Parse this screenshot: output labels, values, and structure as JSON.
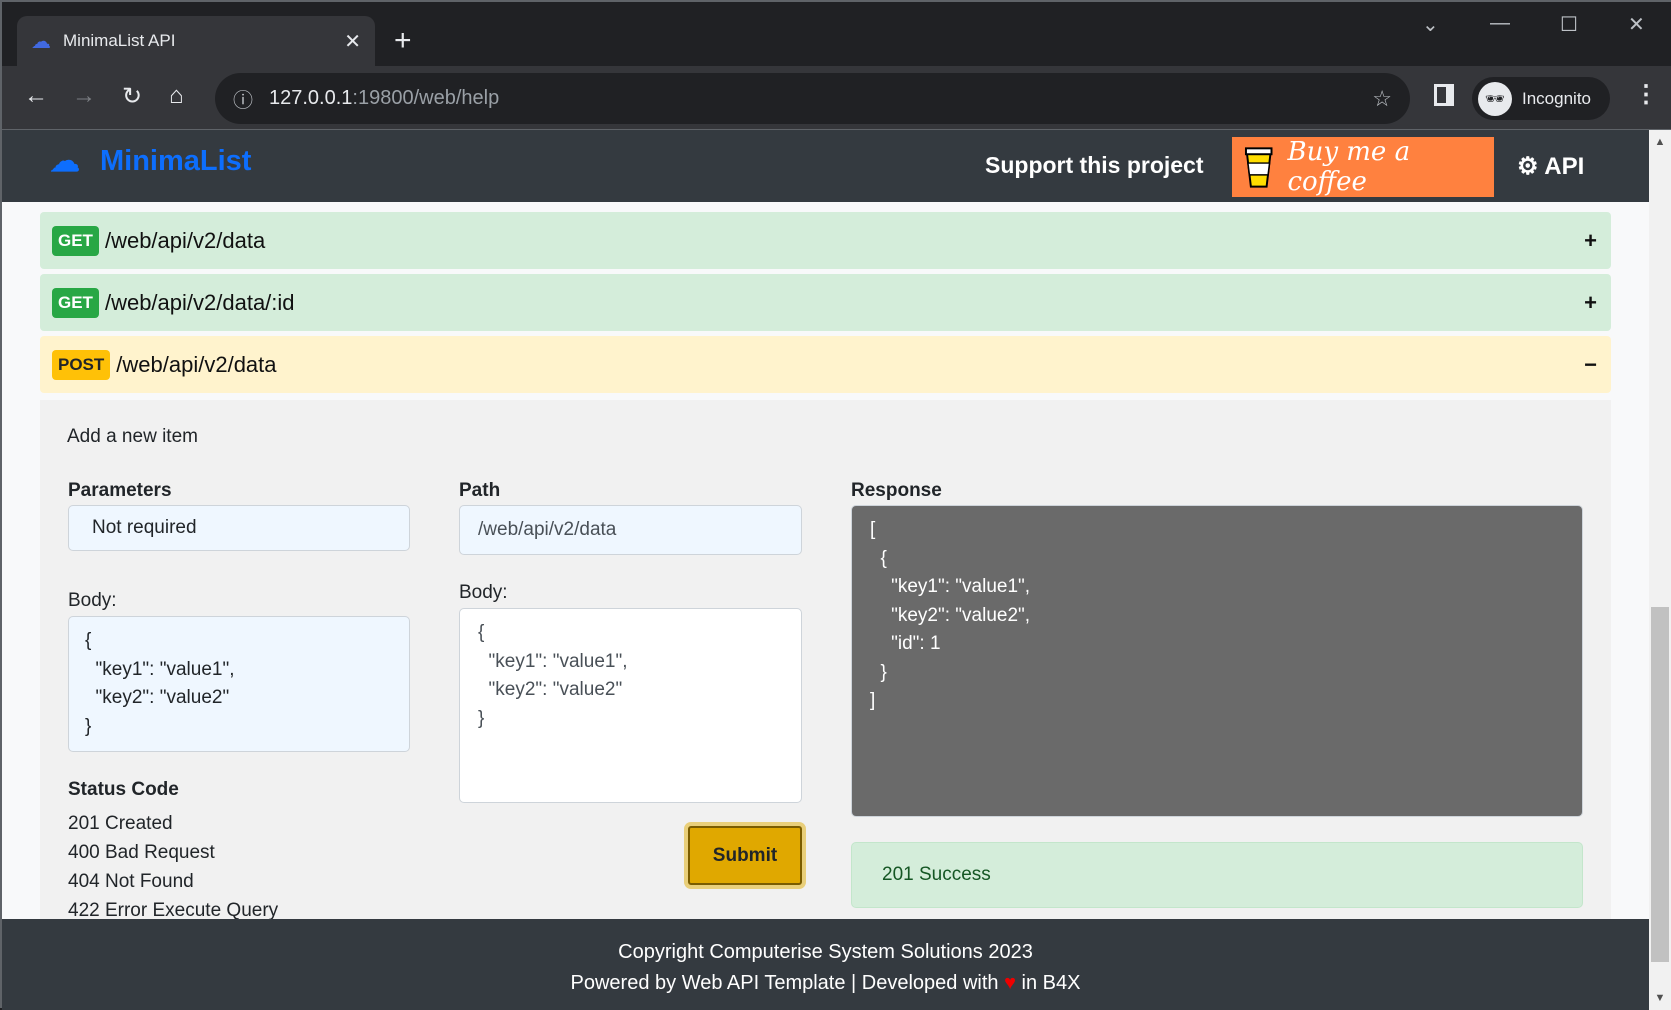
{
  "browser": {
    "tab_title": "MinimaList API",
    "url_host": "127.0.0.1",
    "url_rest": ":19800/web/help",
    "profile": "Incognito"
  },
  "header": {
    "brand": "MinimaList",
    "support": "Support this project",
    "coffee": "Buy me a coffee",
    "api": "API"
  },
  "endpoints": [
    {
      "method": "GET",
      "path": "/web/api/v2/data",
      "toggle": "+",
      "color": "#28a745"
    },
    {
      "method": "GET",
      "path": "/web/api/v2/data/:id",
      "toggle": "+",
      "color": "#28a745"
    },
    {
      "method": "POST",
      "path": "/web/api/v2/data",
      "toggle": "−",
      "color": "#ffc107"
    }
  ],
  "detail": {
    "description": "Add a new item",
    "parameters_label": "Parameters",
    "parameters_value": "Not required",
    "body_label": "Body:",
    "body_example": "{\n  \"key1\": \"value1\",\n  \"key2\": \"value2\"\n}",
    "status_label": "Status Code",
    "status_codes": [
      "201 Created",
      "400 Bad Request",
      "404 Not Found",
      "422 Error Execute Query"
    ],
    "path_label": "Path",
    "path_value": "/web/api/v2/data",
    "path_body_label": "Body:",
    "path_body_value": "{\n  \"key1\": \"value1\",\n  \"key2\": \"value2\"\n}",
    "submit": "Submit",
    "response_label": "Response",
    "response_value": "[\n  {\n    \"key1\": \"value1\",\n    \"key2\": \"value2\",\n    \"id\": 1\n  }\n]",
    "result": "201 Success"
  },
  "footer": {
    "line1": "Copyright Computerise System Solutions 2023",
    "line2_a": "Powered by Web API Template | Developed with",
    "line2_b": "in B4X"
  }
}
